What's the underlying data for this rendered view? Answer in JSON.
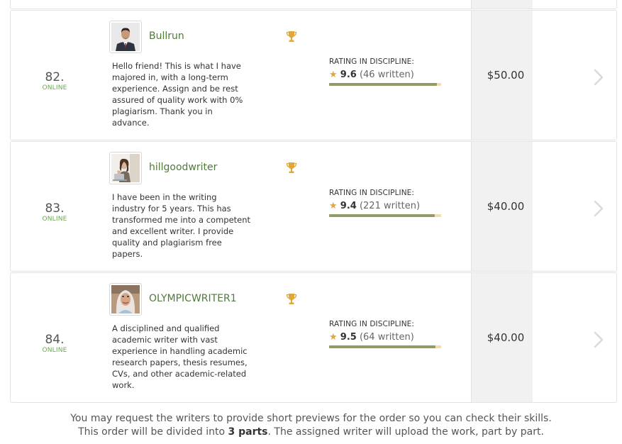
{
  "writers": [
    {
      "rank": "82.",
      "status": "ONLINE",
      "name": "Bullrun",
      "bio": "Hello friend! This is what I have majored in, with a long-term experience. Assign and be rest assured of quality work with 0% plagiarism. Thank you in advance.",
      "rating_label": "RATING IN DISCIPLINE:",
      "rating": "9.6",
      "written": "(46 written)",
      "rating_fraction": 0.96,
      "price": "$50.00"
    },
    {
      "rank": "83.",
      "status": "ONLINE",
      "name": "hillgoodwriter",
      "bio": "I have been in the writing industry for 5 years. This has transformed me into a competent and excellent writer. I provide quality and plagiarism free papers.",
      "rating_label": "RATING IN DISCIPLINE:",
      "rating": "9.4",
      "written": "(221 written)",
      "rating_fraction": 0.94,
      "price": "$40.00"
    },
    {
      "rank": "84.",
      "status": "ONLINE",
      "name": "OLYMPICWRITER1",
      "bio": "A disciplined and qualified academic writer with vast experience in handling academic research papers, thesis resumes, CVs, and other academic-related work.",
      "rating_label": "RATING IN DISCIPLINE:",
      "rating": "9.5",
      "written": "(64 written)",
      "rating_fraction": 0.95,
      "price": "$40.00"
    }
  ],
  "footer": {
    "line1": "You may request the writers to provide short previews for the order so you can check their skills.",
    "line2_prefix": "This order will be divided into ",
    "line2_bold": "3 parts",
    "line2_suffix": ". The assigned writer will upload the work, part by part."
  },
  "colors": {
    "online_green": "#6aa84f",
    "name_green": "#4f7a3a",
    "star_gold": "#e0a83a",
    "bar_fill": "#8f9c6a",
    "bar_track": "#f3dcb0"
  },
  "icons": {
    "trophy": "trophy-icon",
    "chevron": "chevron-right-icon",
    "star": "star-icon"
  }
}
